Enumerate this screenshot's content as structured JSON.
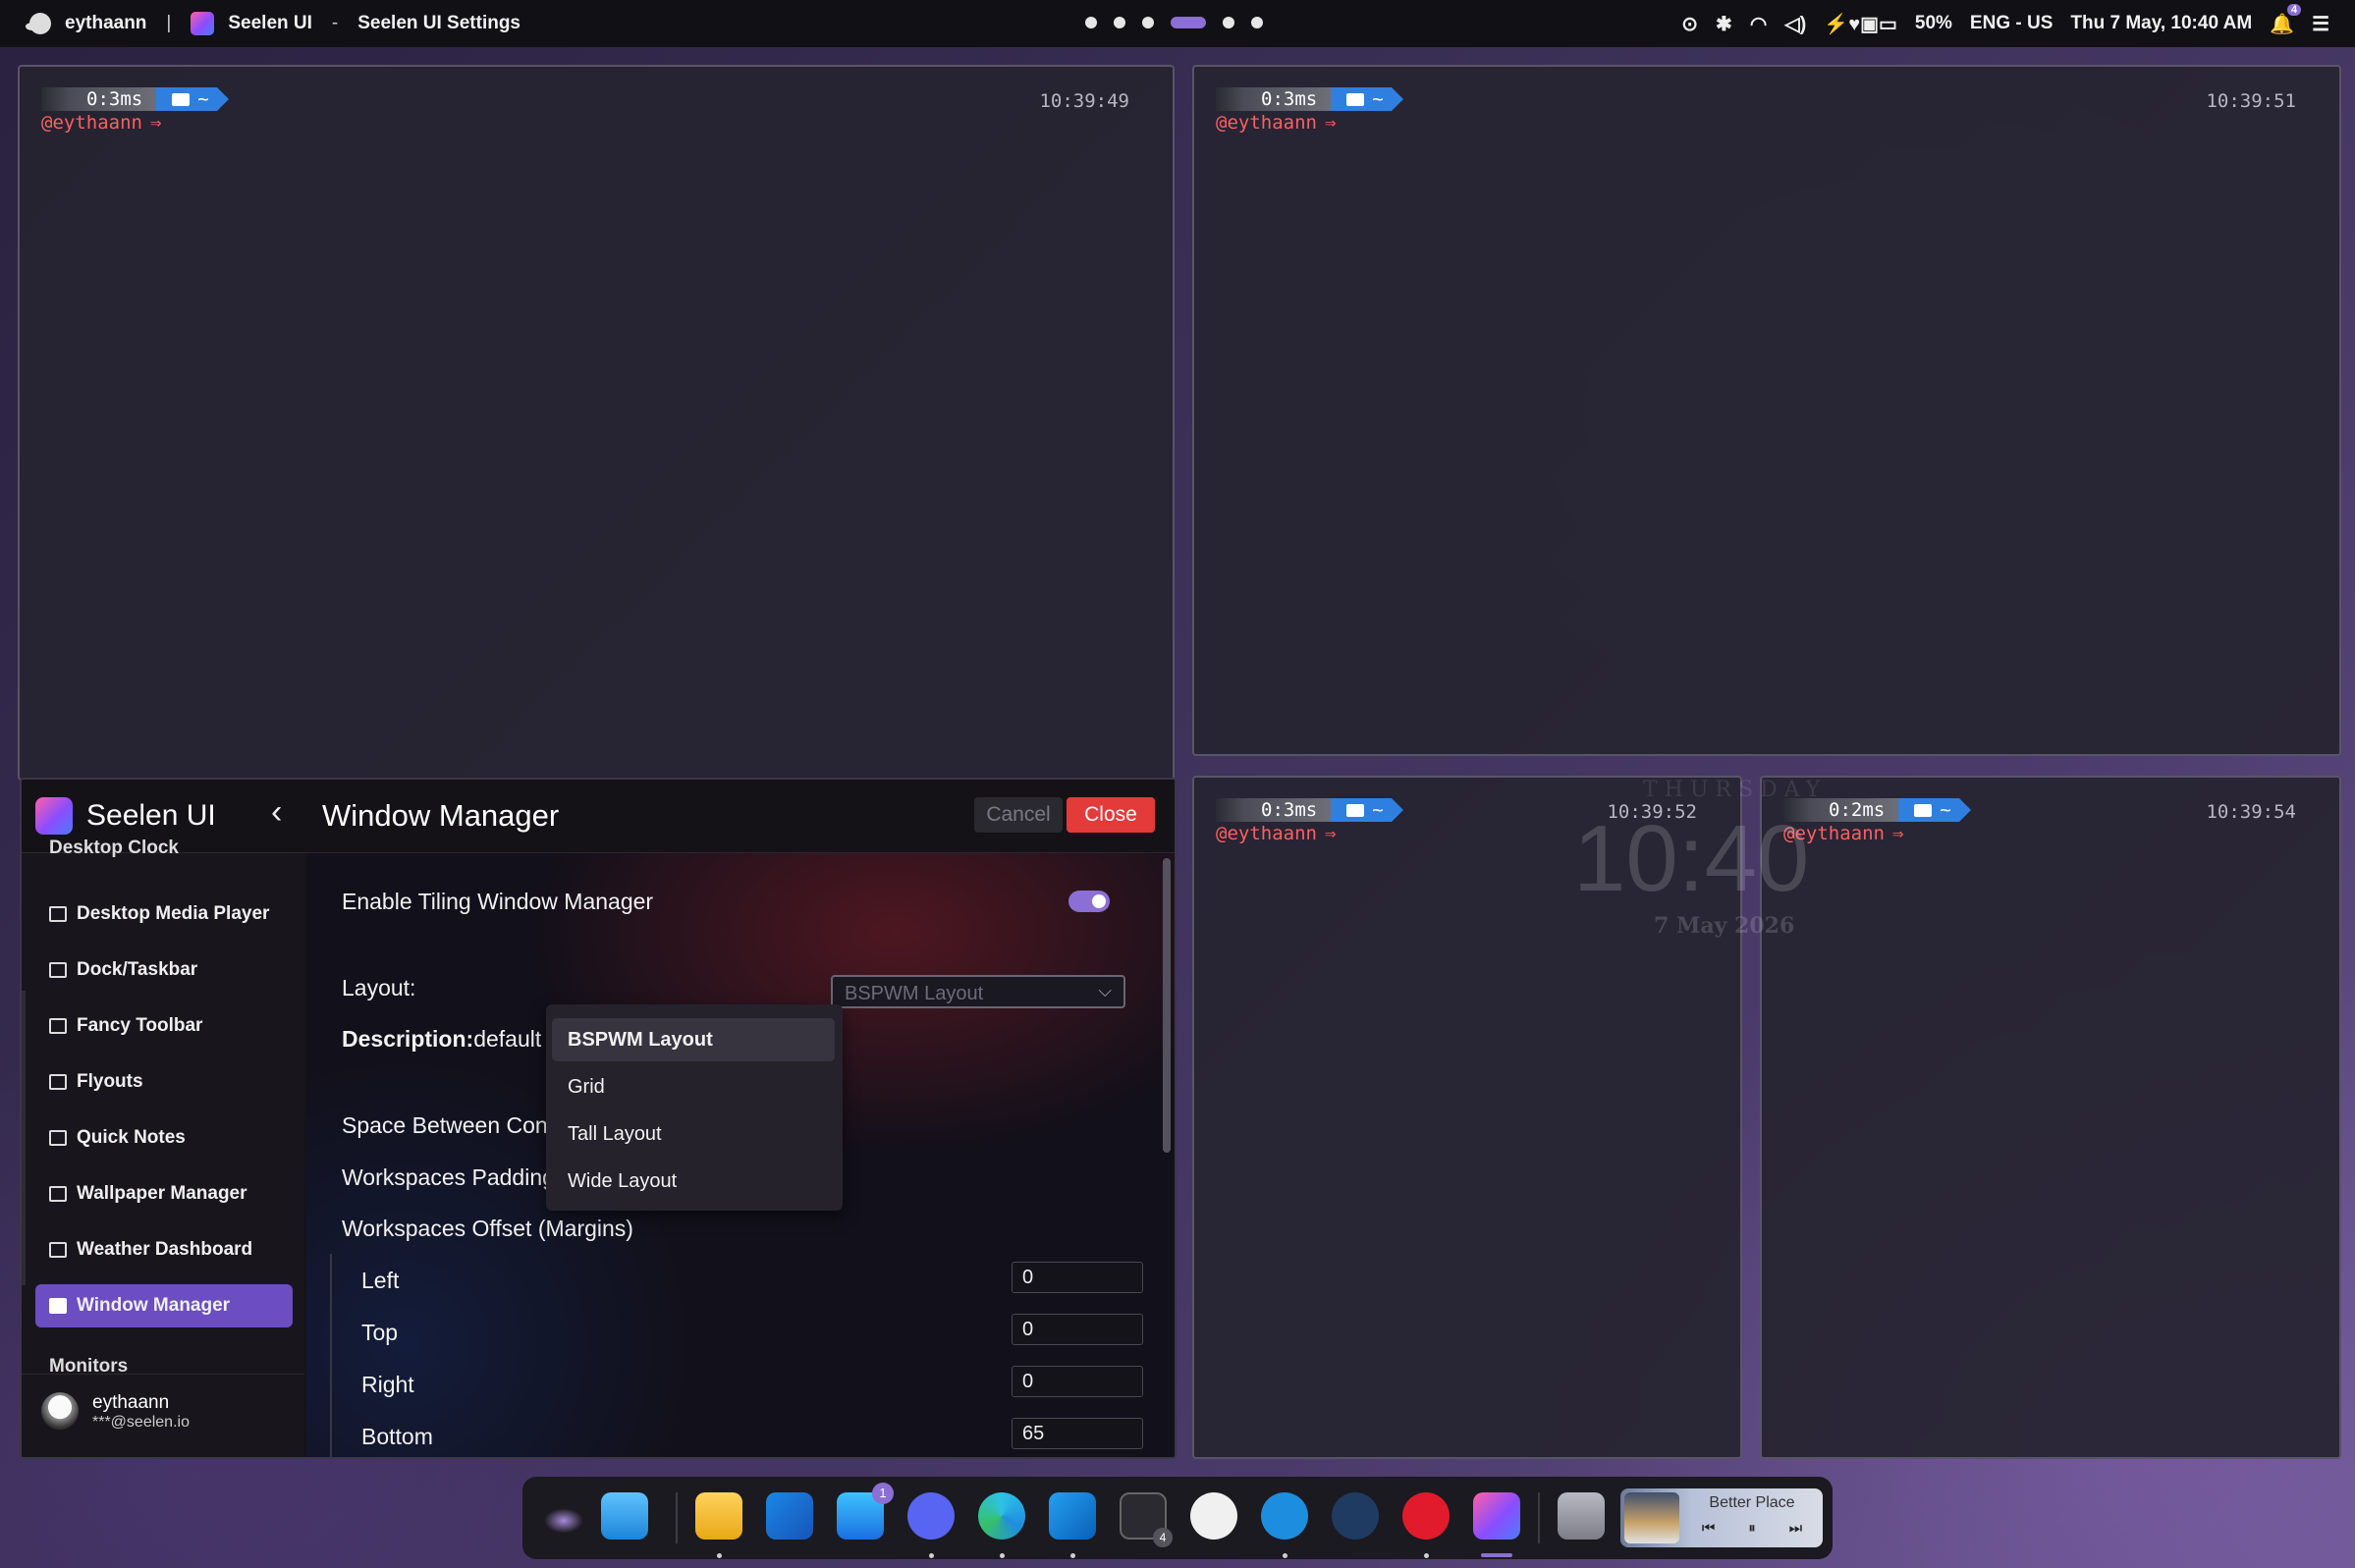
{
  "topbar": {
    "user": "eythaann",
    "separator": "|",
    "app_name": "Seelen UI",
    "dash": "-",
    "window_title": "Seelen UI Settings",
    "battery": "50%",
    "language": "ENG - US",
    "datetime": "Thu 7 May, 10:40 AM",
    "notification_count": "4"
  },
  "terminals": [
    {
      "time": "0:3ms",
      "dir": "~",
      "user": "@eythaann",
      "arrow": "⇒",
      "clock": "10:39:49"
    },
    {
      "time": "0:3ms",
      "dir": "~",
      "user": "@eythaann",
      "arrow": "⇒",
      "clock": "10:39:51"
    },
    {
      "time": "0:3ms",
      "dir": "~",
      "user": "@eythaann",
      "arrow": "⇒",
      "clock": "10:39:52"
    },
    {
      "time": "0:2ms",
      "dir": "~",
      "user": "@eythaann",
      "arrow": "⇒",
      "clock": "10:39:54"
    }
  ],
  "clock_widget": {
    "day": "THURSDAY",
    "time": "10:40",
    "date": "7 May 2026"
  },
  "settings": {
    "app_name": "Seelen UI",
    "back": "‹",
    "page_title": "Window Manager",
    "cancel": "Cancel",
    "close": "Close",
    "sidebar": {
      "clipped_top": "Desktop Clock",
      "items": [
        "Desktop Media Player",
        "Dock/Taskbar",
        "Fancy Toolbar",
        "Flyouts",
        "Quick Notes",
        "Wallpaper Manager",
        "Weather Dashboard",
        "Window Manager"
      ],
      "clipped_bottom": "Monitors",
      "active": "Window Manager"
    },
    "user": {
      "name": "eythaann",
      "email": "***@seelen.io"
    },
    "main": {
      "enable_label": "Enable Tiling Window Manager",
      "enabled": true,
      "layout_label": "Layout:",
      "layout_value": "BSPWM Layout",
      "description_label": "Description:",
      "description_value": "default bspwm tile layout.,",
      "spacing_label": "Space Between Containers",
      "padding_label": "Workspaces Padding",
      "offset_label": "Workspaces Offset (Margins)",
      "offsets": [
        {
          "label": "Left",
          "value": "0"
        },
        {
          "label": "Top",
          "value": "0"
        },
        {
          "label": "Right",
          "value": "0"
        },
        {
          "label": "Bottom",
          "value": "65"
        }
      ]
    },
    "layout_options": [
      "BSPWM Layout",
      "Grid",
      "Tall Layout",
      "Wide Layout"
    ],
    "selected_option": "BSPWM Layout"
  },
  "dock": {
    "apps": [
      "seelen-lips",
      "file-explorer-blue",
      "file-explorer",
      "bird-app",
      "app-store",
      "discord",
      "edge",
      "vscode",
      "terminal",
      "obsidian",
      "docker",
      "steam",
      "youtube-music",
      "seelen-ui",
      "recycle-bin"
    ],
    "badge_app_store": "1",
    "badge_terminal": "4",
    "media_title": "Better Place"
  },
  "colors": {
    "accent": "#8b6fd4",
    "close": "#e33a3a",
    "prompt_user": "#ff5f5f",
    "dir_segment": "#2f7fe0"
  }
}
